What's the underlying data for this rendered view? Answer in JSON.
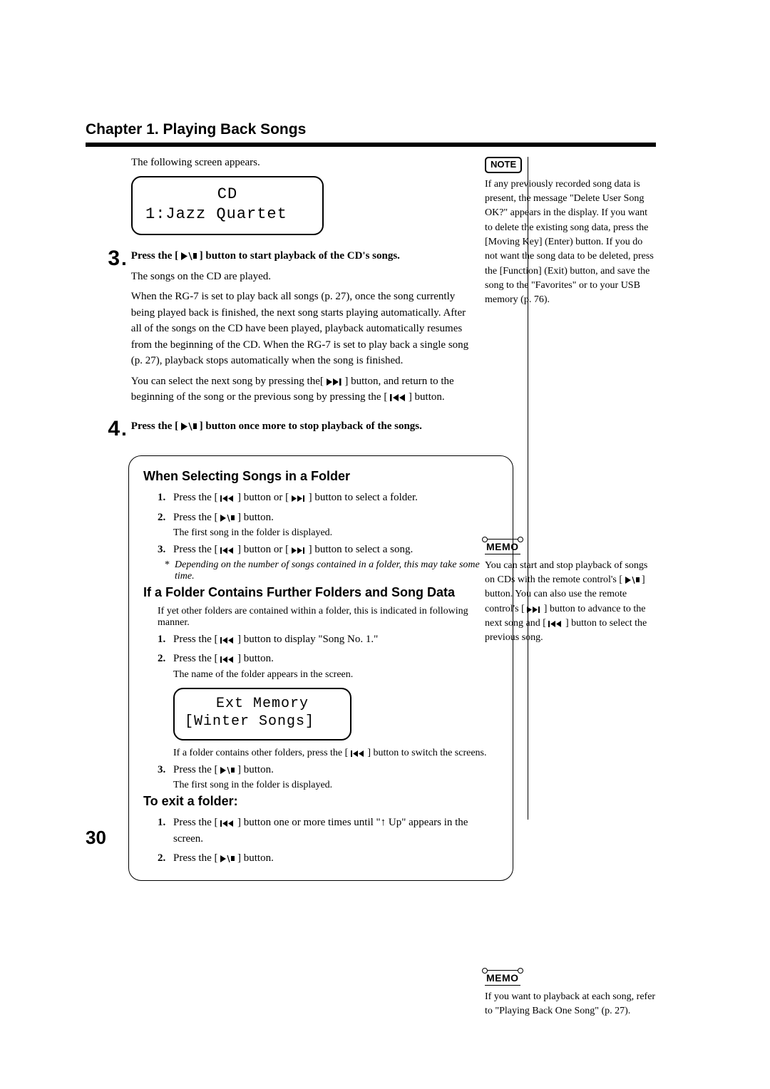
{
  "chapter_title": "Chapter 1. Playing Back Songs",
  "intro": "The following screen appears.",
  "lcd1": {
    "line1": "CD",
    "line2": "1:Jazz Quartet"
  },
  "step3": {
    "num": "3",
    "head_pre": "Press the [ ",
    "head_post": " ] button to start playback of the CD's songs.",
    "p1": "The songs on the CD are played.",
    "p2_a": "When the RG-7 is set to play back all songs (p. 27), once the song currently being played back is finished, the next song starts playing automatically. After all of the songs on the CD have been played, playback automatically resumes from the beginning of the CD. When the RG-7 is set to play back a single song (p. 27), playback stops automatically when the song is finished.",
    "p3_a": "You can select the next song by pressing the[ ",
    "p3_b": " ] button, and return to the beginning of the song or the previous song by pressing the [ ",
    "p3_c": " ] button."
  },
  "step4": {
    "num": "4",
    "head_pre": "Press the [ ",
    "head_post": " ] button once more to stop playback of the songs."
  },
  "box": {
    "h1": "When Selecting Songs in a Folder",
    "l1_pre": "Press the [ ",
    "l1_mid": " ] button or [ ",
    "l1_post": " ] button to select a folder.",
    "l2_pre": "Press the [ ",
    "l2_post": " ] button.",
    "l2_note": "The first song in the folder is displayed.",
    "l3_pre": "Press the [ ",
    "l3_mid": " ] button or [ ",
    "l3_post": " ] button to select a song.",
    "l3_note": "Depending on the number of songs contained in a folder, this may take some time.",
    "h2": "If a Folder Contains Further Folders and Song Data",
    "h2_intro": "If yet other folders are contained within a folder, this is indicated in following manner.",
    "f1_pre": "Press the [ ",
    "f1_post": " ] button to display \"Song No. 1.\"",
    "f2_pre": "Press the [ ",
    "f2_post": " ] button.",
    "f2_note": "The name of the folder appears in the screen.",
    "lcd2": {
      "line1": "Ext Memory",
      "line2": "[Winter Songs]"
    },
    "f_after_pre": "If a folder contains other folders, press the [ ",
    "f_after_post": " ] button to switch the screens.",
    "f3_pre": "Press the [ ",
    "f3_post": " ] button.",
    "f3_note": "The first song in the folder is displayed.",
    "h3": "To exit a folder:",
    "e1_pre": "Press the [ ",
    "e1_post": " ] button one or more times until \"↑ Up\" appears in the screen.",
    "e2_pre": "Press the [ ",
    "e2_post": " ] button."
  },
  "side": {
    "note_tag": "NOTE",
    "note_text": "If any previously recorded song data is present, the message \"Delete User Song OK?\" appears in the display. If you want to delete the existing song data, press the [Moving Key] (Enter) button. If you do not want the song data to be deleted, press the [Function] (Exit) button, and save the song to the \"Favorites\" or to your USB memory (p. 76).",
    "memo_tag": "MEMO",
    "memo1_a": "You can start and stop playback of songs on CDs with the remote control's [ ",
    "memo1_b": " ] button. You can also use the remote control's [ ",
    "memo1_c": " ] button to advance to the next song and [ ",
    "memo1_d": " ] button to select the previous song.",
    "memo2": "If you want to playback at each song, refer to \"Playing Back One Song\" (p. 27)."
  },
  "page_number": "30"
}
